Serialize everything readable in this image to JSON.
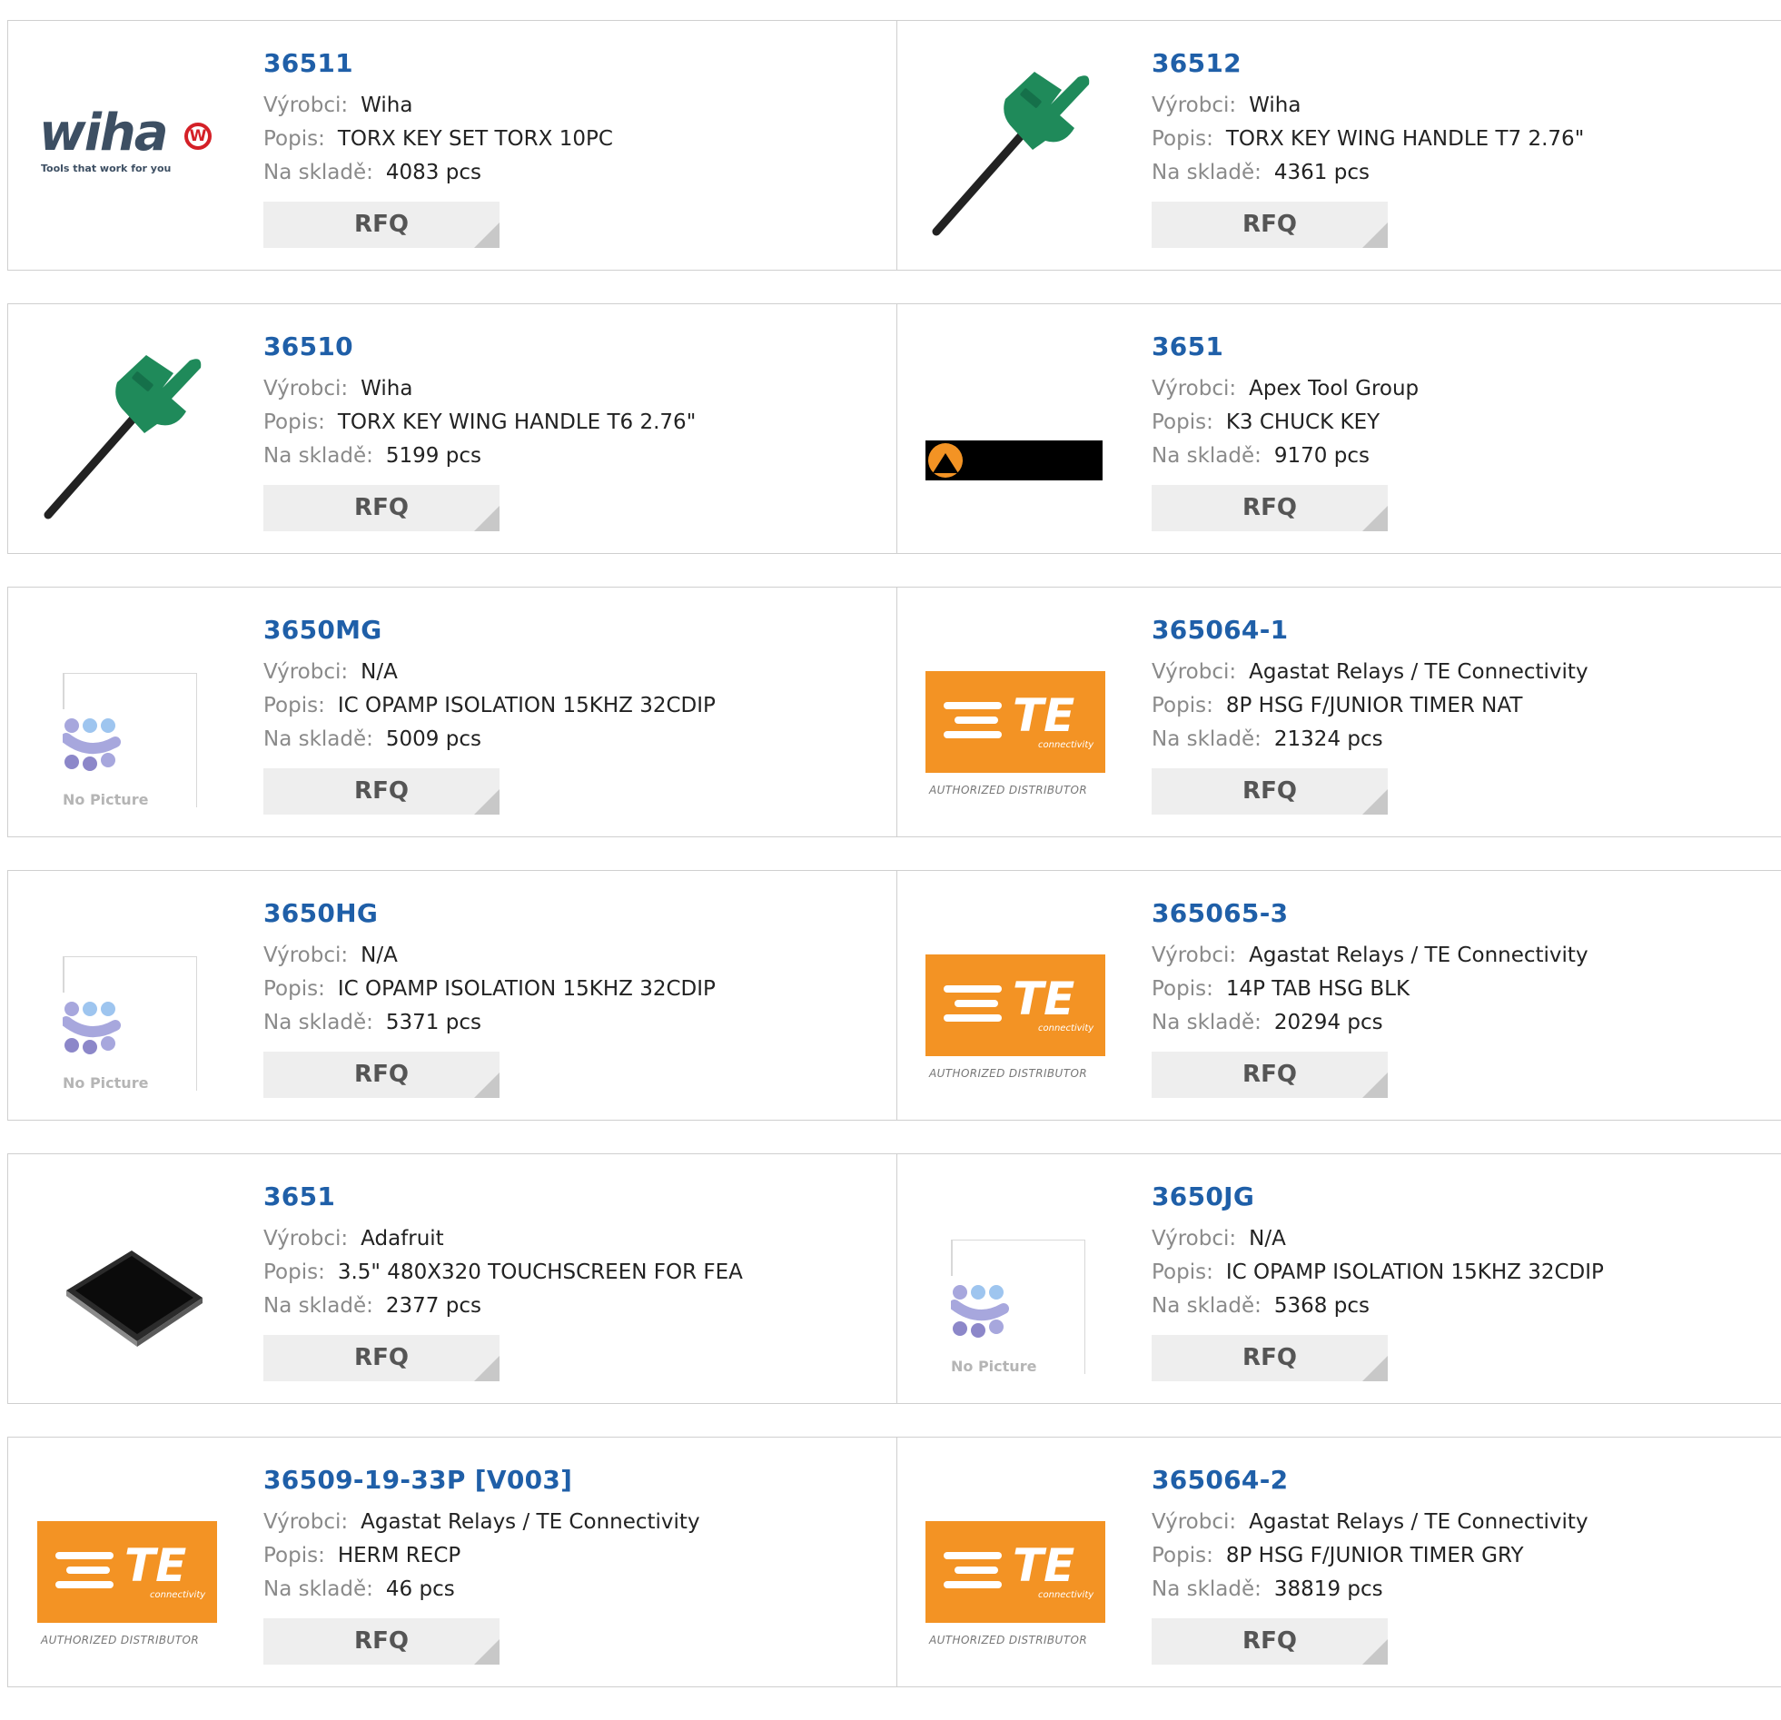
{
  "labels": {
    "manufacturer": "Výrobci:",
    "description": "Popis:",
    "stock": "Na skladě:",
    "rfq": "RFQ"
  },
  "rows": [
    {
      "left": {
        "part": "36511",
        "manufacturer": "Wiha",
        "description": "TORX KEY SET TORX 10PC",
        "stock": "4083 pcs",
        "image": "wiha-logo"
      },
      "right": {
        "part": "36512",
        "manufacturer": "Wiha",
        "description": "TORX KEY WING HANDLE T7 2.76\"",
        "stock": "4361 pcs",
        "image": "torx-wing-key"
      }
    },
    {
      "left": {
        "part": "36510",
        "manufacturer": "Wiha",
        "description": "TORX KEY WING HANDLE T6 2.76\"",
        "stock": "5199 pcs",
        "image": "torx-wing-key"
      },
      "right": {
        "part": "3651",
        "manufacturer": "Apex Tool Group",
        "description": "K3 CHUCK KEY",
        "stock": "9170 pcs",
        "image": "apex-logo"
      }
    },
    {
      "left": {
        "part": "3650MG",
        "manufacturer": "N/A",
        "description": "IC OPAMP ISOLATION 15KHZ 32CDIP",
        "stock": "5009 pcs",
        "image": "no-picture"
      },
      "right": {
        "part": "365064-1",
        "manufacturer": "Agastat Relays / TE Connectivity",
        "description": "8P HSG F/JUNIOR TIMER NAT",
        "stock": "21324 pcs",
        "image": "te-logo"
      }
    },
    {
      "left": {
        "part": "3650HG",
        "manufacturer": "N/A",
        "description": "IC OPAMP ISOLATION 15KHZ 32CDIP",
        "stock": "5371 pcs",
        "image": "no-picture"
      },
      "right": {
        "part": "365065-3",
        "manufacturer": "Agastat Relays / TE Connectivity",
        "description": "14P TAB HSG BLK",
        "stock": "20294 pcs",
        "image": "te-logo"
      }
    },
    {
      "left": {
        "part": "3651",
        "manufacturer": "Adafruit",
        "description": "3.5\" 480X320 TOUCHSCREEN FOR FEA",
        "stock": "2377 pcs",
        "image": "touchscreen"
      },
      "right": {
        "part": "3650JG",
        "manufacturer": "N/A",
        "description": "IC OPAMP ISOLATION 15KHZ 32CDIP",
        "stock": "5368 pcs",
        "image": "no-picture"
      }
    },
    {
      "left": {
        "part": "36509-19-33P [V003]",
        "manufacturer": "Agastat Relays / TE Connectivity",
        "description": "HERM RECP",
        "stock": "46 pcs",
        "image": "te-logo"
      },
      "right": {
        "part": "365064-2",
        "manufacturer": "Agastat Relays / TE Connectivity",
        "description": "8P HSG F/JUNIOR TIMER GRY",
        "stock": "38819 pcs",
        "image": "te-logo"
      }
    }
  ],
  "image_text": {
    "wiha_word": "wiha",
    "wiha_badge": "W",
    "wiha_tagline": "Tools that work for you",
    "te_word": "TE",
    "te_sub": "connectivity",
    "te_authorized": "AUTHORIZED DISTRIBUTOR",
    "no_picture": "No Picture"
  },
  "colors": {
    "part_link": "#1f5fa8",
    "label": "#8a8a8a",
    "rfq_bg": "#eeeeee",
    "te_orange": "#f39324",
    "wiha_red": "#d42027",
    "key_green": "#1f8a5a"
  }
}
